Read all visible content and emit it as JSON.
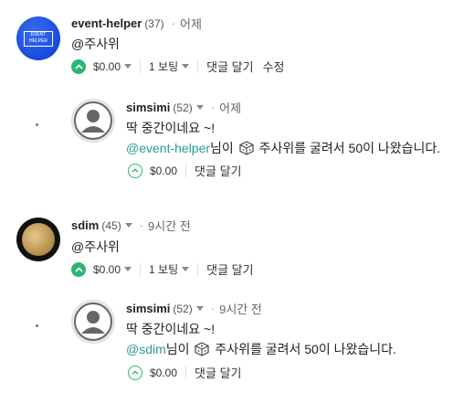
{
  "comments": [
    {
      "author": "event-helper",
      "rep": "(37)",
      "time": "어제",
      "body": "@주사위",
      "amount": "$0.00",
      "votes": "1 보팅",
      "reply": "댓글 달기",
      "edit": "수정",
      "avatar": "EVENT HELPER"
    },
    {
      "author": "simsimi",
      "rep": "(52)",
      "time": "어제",
      "body": "딱 중간이네요 ~!",
      "mention": "@event-helper",
      "msg_tail1": "님이",
      "msg_tail2": "주사위를 굴려서 50이 나왔습니다.",
      "amount": "$0.00",
      "reply": "댓글 달기"
    },
    {
      "author": "sdim",
      "rep": "(45)",
      "time": "9시간 전",
      "body": "@주사위",
      "amount": "$0.00",
      "votes": "1 보팅",
      "reply": "댓글 달기"
    },
    {
      "author": "simsimi",
      "rep": "(52)",
      "time": "9시간 전",
      "body": "딱 중간이네요 ~!",
      "mention": "@sdim",
      "msg_tail1": "님이",
      "msg_tail2": "주사위를 굴려서 50이 나왔습니다.",
      "amount": "$0.00",
      "reply": "댓글 달기"
    }
  ],
  "colors": {
    "upvote": "#2bb673",
    "mention": "#2a9d8f"
  },
  "icons": {
    "upvote": "chevron-up-icon",
    "dice": "dice-icon",
    "dropdown": "caret-down-icon"
  }
}
